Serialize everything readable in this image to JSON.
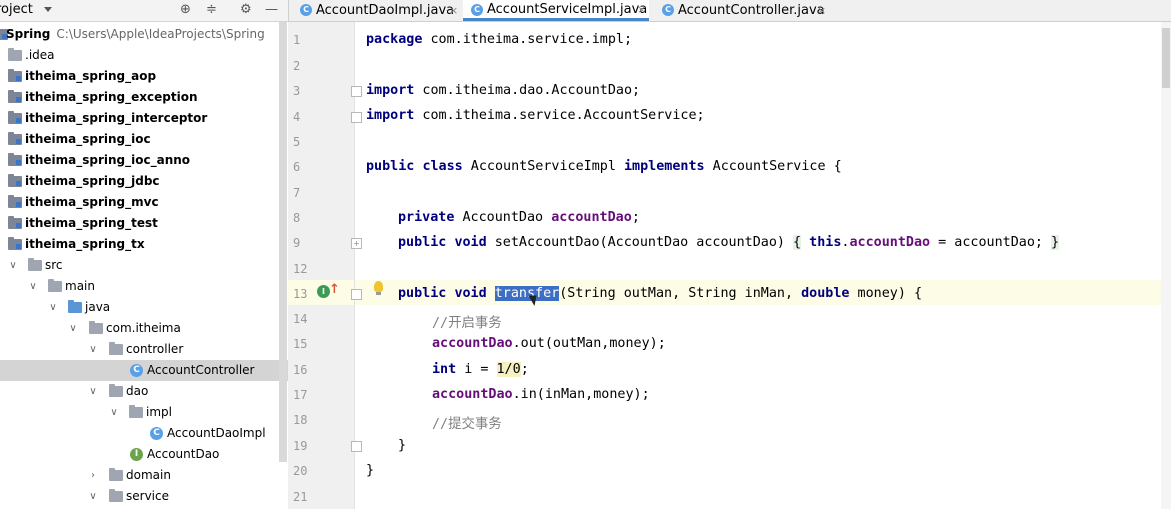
{
  "project_panel": {
    "title": "roject",
    "tree": [
      {
        "label": "Spring",
        "path": "C:\\Users\\Apple\\IdeaProjects\\Spring",
        "bold": true,
        "type": "module-root"
      },
      {
        "label": ".idea",
        "type": "folder"
      },
      {
        "label": "itheima_spring_aop",
        "bold": true,
        "type": "module"
      },
      {
        "label": "itheima_spring_exception",
        "bold": true,
        "type": "module"
      },
      {
        "label": "itheima_spring_interceptor",
        "bold": true,
        "type": "module"
      },
      {
        "label": "itheima_spring_ioc",
        "bold": true,
        "type": "module"
      },
      {
        "label": "itheima_spring_ioc_anno",
        "bold": true,
        "type": "module"
      },
      {
        "label": "itheima_spring_jdbc",
        "bold": true,
        "type": "module"
      },
      {
        "label": "itheima_spring_mvc",
        "bold": true,
        "type": "module"
      },
      {
        "label": "itheima_spring_test",
        "bold": true,
        "type": "module"
      },
      {
        "label": "itheima_spring_tx",
        "bold": true,
        "type": "module"
      },
      {
        "label": "src",
        "type": "folder"
      },
      {
        "label": "main",
        "type": "folder"
      },
      {
        "label": "java",
        "type": "source-folder"
      },
      {
        "label": "com.itheima",
        "type": "package"
      },
      {
        "label": "controller",
        "type": "package"
      },
      {
        "label": "AccountController",
        "type": "class",
        "selected": true
      },
      {
        "label": "dao",
        "type": "package"
      },
      {
        "label": "impl",
        "type": "package"
      },
      {
        "label": "AccountDaoImpl",
        "type": "class"
      },
      {
        "label": "AccountDao",
        "type": "interface"
      },
      {
        "label": "domain",
        "type": "package"
      },
      {
        "label": "service",
        "type": "package"
      }
    ]
  },
  "tabs": [
    {
      "label": "AccountDaoImpl.java",
      "close": "×"
    },
    {
      "label": "AccountServiceImpl.java",
      "close": "×",
      "active": true
    },
    {
      "label": "AccountController.java",
      "close": "×"
    }
  ],
  "editor": {
    "lines": [
      {
        "num": "1",
        "text": "package com.itheima.service.impl;"
      },
      {
        "num": "2",
        "text": ""
      },
      {
        "num": "3",
        "text": "import com.itheima.dao.AccountDao;"
      },
      {
        "num": "4",
        "text": "import com.itheima.service.AccountService;"
      },
      {
        "num": "5",
        "text": ""
      },
      {
        "num": "6",
        "text": "public class AccountServiceImpl implements AccountService {"
      },
      {
        "num": "7",
        "text": ""
      },
      {
        "num": "8",
        "text": "    private AccountDao accountDao;"
      },
      {
        "num": "9",
        "text": "    public void setAccountDao(AccountDao accountDao) { this.accountDao = accountDao; }"
      },
      {
        "num": "12",
        "text": ""
      },
      {
        "num": "13",
        "text": "    public void transfer(String outMan, String inMan, double money) {"
      },
      {
        "num": "14",
        "text": "        //开启事务"
      },
      {
        "num": "15",
        "text": "        accountDao.out(outMan,money);"
      },
      {
        "num": "16",
        "text": "        int i = 1/0;"
      },
      {
        "num": "17",
        "text": "        accountDao.in(inMan,money);"
      },
      {
        "num": "18",
        "text": "        //提交事务"
      },
      {
        "num": "19",
        "text": "    }"
      },
      {
        "num": "20",
        "text": "}"
      },
      {
        "num": "21",
        "text": ""
      }
    ],
    "tokens": {
      "kw_package": "package",
      "pkg_name": " com.itheima.service.impl;",
      "kw_import": "import",
      "imp1": " com.itheima.dao.AccountDao;",
      "imp2": " com.itheima.service.AccountService;",
      "kw_public": "public",
      "kw_class": "class",
      "cls_name": " AccountServiceImpl ",
      "kw_implements": "implements",
      "cls_tail": " AccountService {",
      "kw_private": "private",
      "type_dao": " AccountDao ",
      "fld_accountDao": "accountDao",
      "semicolon": ";",
      "kw_void": "void",
      "setter_sig": " setAccountDao(AccountDao accountDao) ",
      "brace_open": "{",
      "kw_this": "this",
      "dot": ".",
      "assign_tail": " = accountDao; ",
      "brace_close": "}",
      "method_name": "transfer",
      "params_a": "(String outMan, String inMan, ",
      "kw_double": "double",
      "params_b": " money) {",
      "comment1": "//开启事务",
      "call_out": ".out(outMan,money);",
      "kw_int": "int",
      "int_mid": " i = ",
      "expr": "1/0",
      "call_in": ".in(inMan,money);",
      "comment2": "//提交事务",
      "close_method": "}",
      "close_class": "}"
    }
  },
  "colors": {
    "keyword": "#00007f",
    "field": "#660e7a",
    "comment": "#808080",
    "selection": "#3c6ec3",
    "current_line": "#fdfce6",
    "tab_underline": "#4a86c7"
  },
  "icons": [
    "settings-target-icon",
    "collapse-icon",
    "gear-icon",
    "minimize-icon",
    "implements-gutter-icon",
    "intention-bulb-icon",
    "mouse-cursor-icon"
  ]
}
